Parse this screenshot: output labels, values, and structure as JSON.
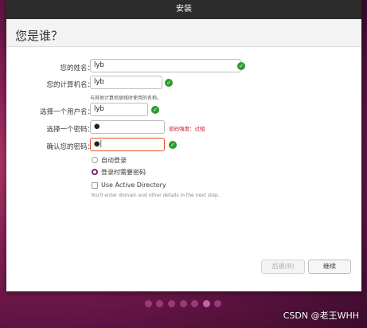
{
  "window": {
    "title": "安装",
    "heading": "您是谁？"
  },
  "form": {
    "name": {
      "label": "您的姓名：",
      "value": "lyb"
    },
    "computer": {
      "label": "您的计算机名：",
      "value": "lyb",
      "hint": "与其他计算机联络时使用的名称。"
    },
    "username": {
      "label": "选择一个用户名：",
      "value": "lyb"
    },
    "password": {
      "label": "选择一个密码：",
      "value": "●",
      "strength": "密码强度：过短"
    },
    "confirm": {
      "label": "确认您的密码：",
      "value": "●|"
    },
    "options": {
      "autologin": "自动登录",
      "require_password": "登录时需要密码",
      "selected": "require_password",
      "active_directory": "Use Active Directory",
      "active_directory_checked": false,
      "ad_note": "You'll enter domain and other details in the next step."
    }
  },
  "buttons": {
    "back": "后退(B)",
    "continue": "继续"
  },
  "progress": {
    "total": 7,
    "current": 6
  },
  "watermark": "CSDN @老王WHH",
  "colors": {
    "accent": "#77216f",
    "focus": "#e95420",
    "ok": "#2a9d2a",
    "warning": "#c7162b"
  }
}
